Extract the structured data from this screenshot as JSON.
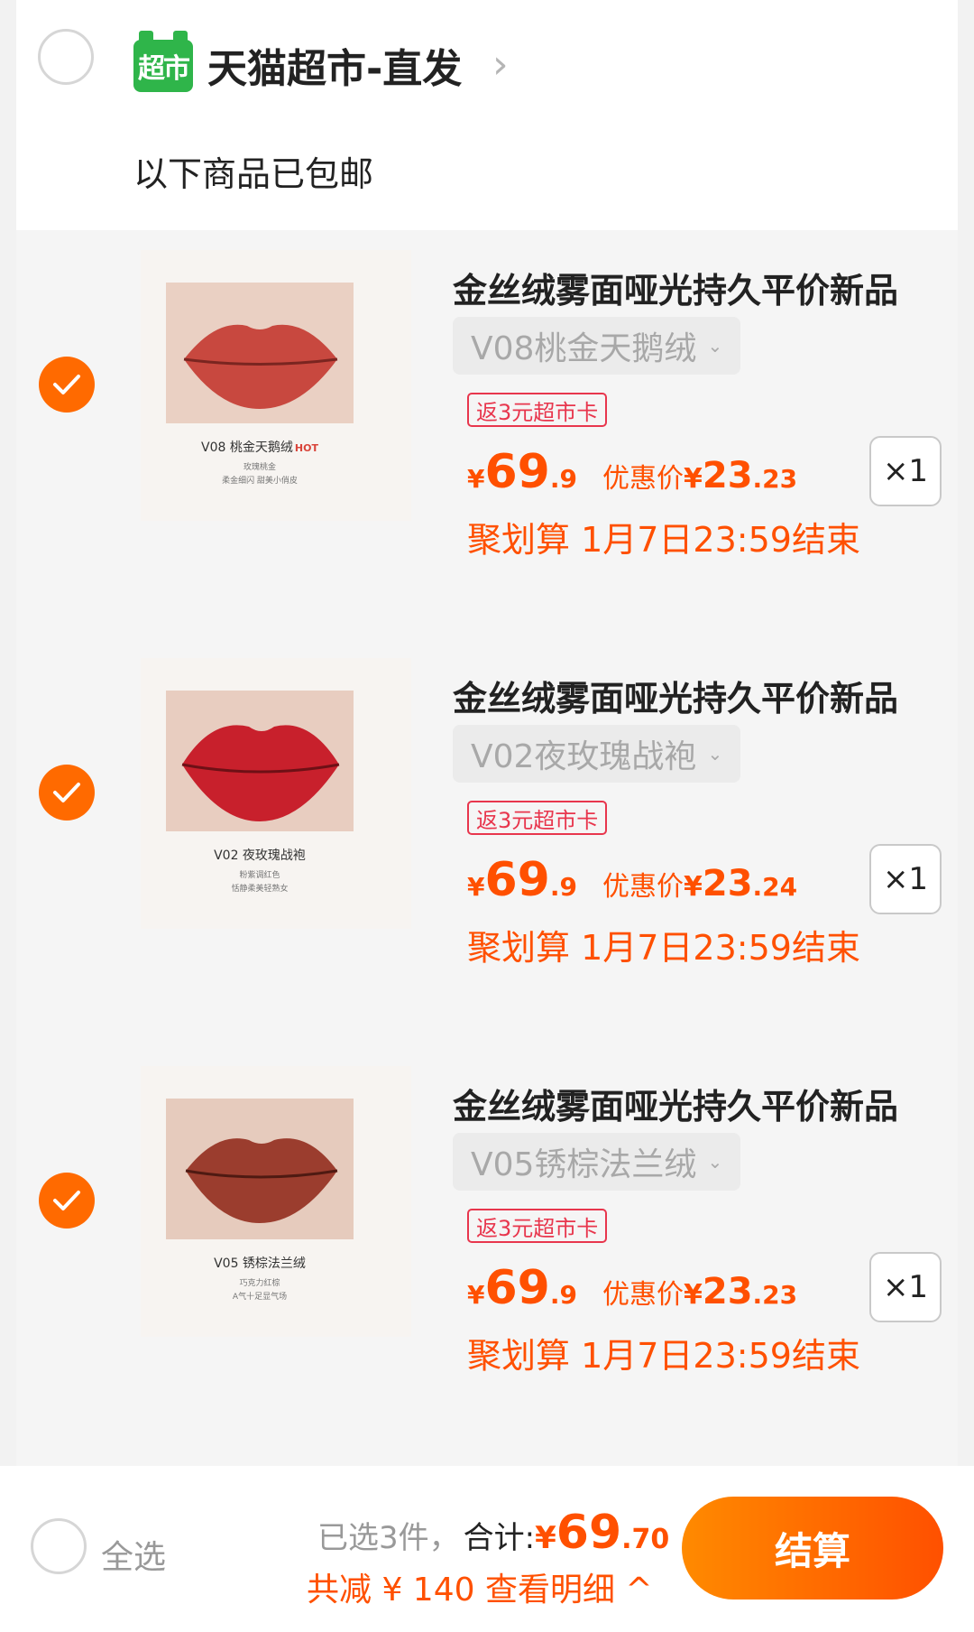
{
  "store": {
    "logo_text": "超市",
    "name": "天猫超市-直发",
    "chevron": "›",
    "shipping_note": "以下商品已包邮"
  },
  "items": [
    {
      "checked": true,
      "thumb_code": "V08 桃金天鹅绒",
      "thumb_hot": "HOT",
      "thumb_desc1": "玫瑰桃金",
      "thumb_desc2": "柔金细闪 甜美小俏皮",
      "lip_color": "#c8483f",
      "title": "金丝绒雾面哑光持久平价新品",
      "sku": "V08桃金天鹅绒",
      "badge": "返3元超市卡",
      "price_yen": "¥",
      "price_int": "69",
      "price_dec": ".9",
      "promo_label": "优惠价",
      "promo_yen": "¥",
      "promo_int": "23",
      "promo_dec": ".23",
      "qty": "×1",
      "deal": "聚划算 1月7日23:59结束"
    },
    {
      "checked": true,
      "thumb_code": "V02 夜玫瑰战袍",
      "thumb_hot": "",
      "thumb_desc1": "粉紫调红色",
      "thumb_desc2": "恬静柔美轻熟女",
      "lip_color": "#c8202c",
      "title": "金丝绒雾面哑光持久平价新品",
      "sku": "V02夜玫瑰战袍",
      "badge": "返3元超市卡",
      "price_yen": "¥",
      "price_int": "69",
      "price_dec": ".9",
      "promo_label": "优惠价",
      "promo_yen": "¥",
      "promo_int": "23",
      "promo_dec": ".24",
      "qty": "×1",
      "deal": "聚划算 1月7日23:59结束"
    },
    {
      "checked": true,
      "thumb_code": "V05 锈棕法兰绒",
      "thumb_hot": "",
      "thumb_desc1": "巧克力红棕",
      "thumb_desc2": "A气十足显气场",
      "lip_color": "#9b3d2e",
      "title": "金丝绒雾面哑光持久平价新品",
      "sku": "V05锈棕法兰绒",
      "badge": "返3元超市卡",
      "price_yen": "¥",
      "price_int": "69",
      "price_dec": ".9",
      "promo_label": "优惠价",
      "promo_yen": "¥",
      "promo_int": "23",
      "promo_dec": ".23",
      "qty": "×1",
      "deal": "聚划算 1月7日23:59结束"
    }
  ],
  "footer": {
    "select_all": "全选",
    "selected_count": "已选3件，",
    "total_label": "合计:",
    "total_yen": "¥",
    "total_int": "69",
    "total_dec": ".70",
    "discount": "共减 ¥ 140 查看明细 ^",
    "checkout": "结算"
  },
  "colors": {
    "accent": "#ff5000",
    "badge": "#e8364d",
    "store_logo": "#2fb54a"
  }
}
